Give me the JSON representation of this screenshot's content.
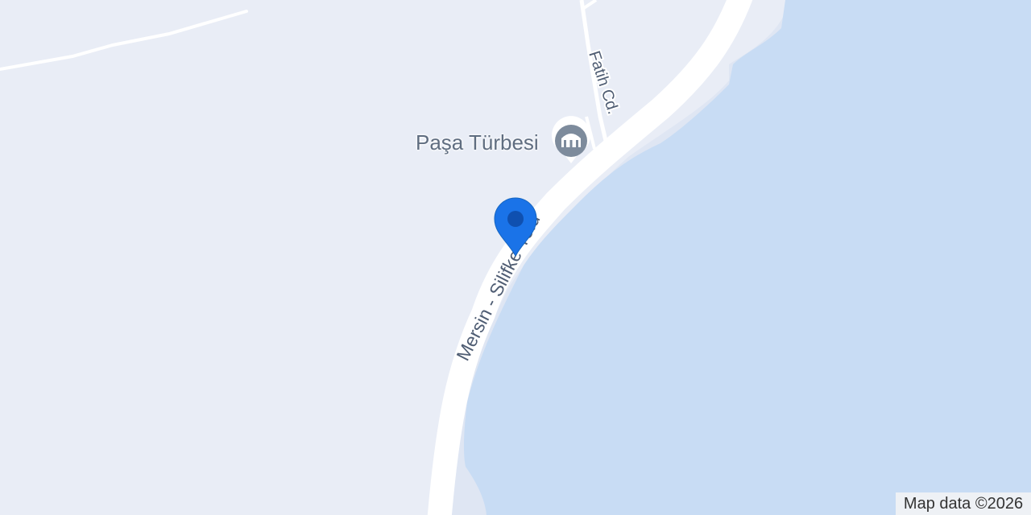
{
  "map": {
    "roads": [
      {
        "name": "Mersin - Silifke Yolu"
      },
      {
        "name": "Fatih Cd."
      }
    ],
    "poi": {
      "label": "Paşa Türbesi",
      "icon": "mausoleum-icon"
    },
    "marker": {
      "icon": "location-pin-icon",
      "color": "#1a73e8"
    },
    "attribution": "Map data ©2026"
  },
  "colors": {
    "land": "#e9edf6",
    "water": "#c8dcf4",
    "shore": "#dfe6f3",
    "road": "#ffffff",
    "road_label": "#4f5d73",
    "poi_icon": "#7d8b9c"
  }
}
